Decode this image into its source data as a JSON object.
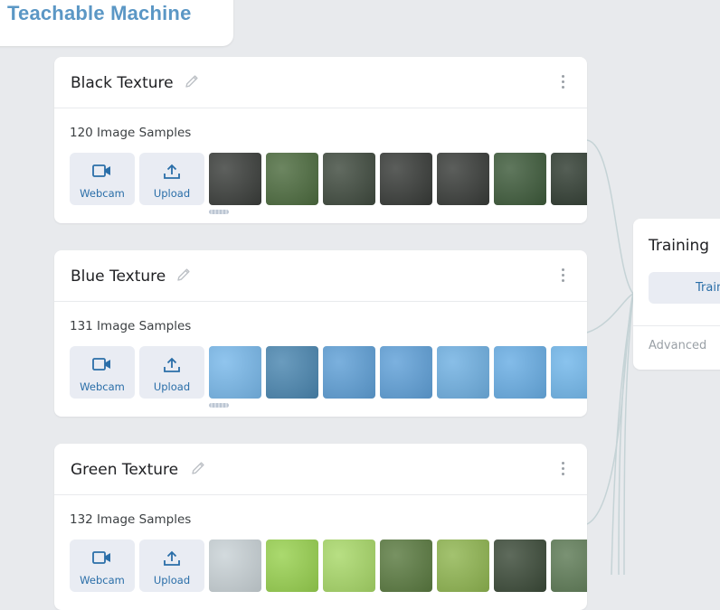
{
  "app": {
    "title": "Teachable Machine"
  },
  "colors": {
    "accent": "#2a6ea8",
    "logo": "#5b97c5",
    "background": "#e8eaed",
    "connector": "#c5d3d6"
  },
  "classes": [
    {
      "name": "Black Texture",
      "samples_label": "120 Image Samples",
      "thumbnails": [
        "#3a3d3a",
        "#4c6b3e",
        "#3f4a3e",
        "#373a37",
        "#383b38",
        "#3d5a3a",
        "#2f3b30"
      ]
    },
    {
      "name": "Blue Texture",
      "samples_label": "131 Image Samples",
      "thumbnails": [
        "#78b8ea",
        "#4a86b0",
        "#5e9fd6",
        "#5fa0d8",
        "#6fb0e2",
        "#68ade4",
        "#70b6ea"
      ]
    },
    {
      "name": "Green Texture",
      "samples_label": "132 Image Samples",
      "thumbnails": [
        "#c9d2d6",
        "#98d14f",
        "#a8d868",
        "#5a7a40",
        "#8fb550",
        "#3b4a38",
        "#5d7a55"
      ]
    }
  ],
  "source_buttons": {
    "webcam": "Webcam",
    "upload": "Upload"
  },
  "training": {
    "title": "Training",
    "train_button": "Train",
    "advanced_label": "Advanced"
  },
  "icons": {
    "webcam": "video-camera-icon",
    "upload": "upload-arrow-icon",
    "edit": "pencil-icon",
    "menu": "more-vert-icon"
  }
}
